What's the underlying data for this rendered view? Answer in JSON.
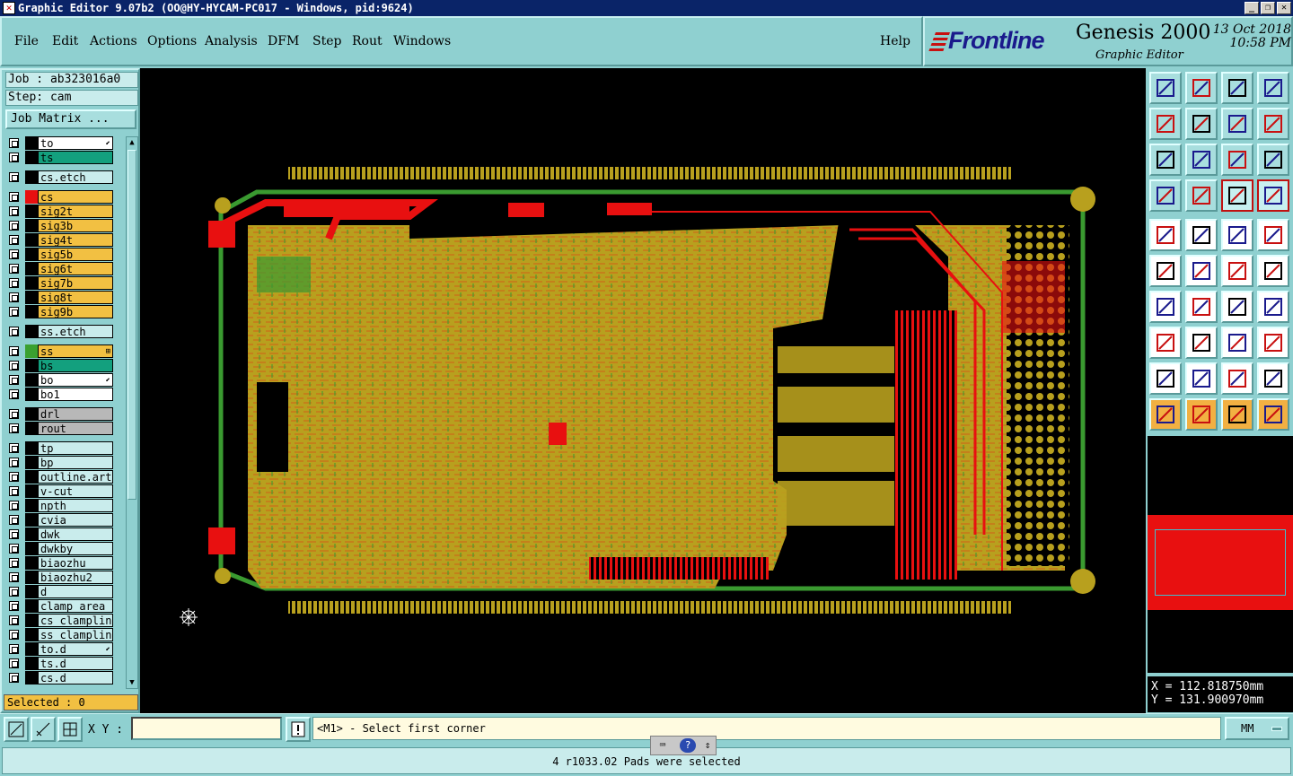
{
  "window": {
    "title": "Graphic Editor 9.07b2 (OO@HY-HYCAM-PC017 - Windows, pid:9624)"
  },
  "menu": {
    "items": [
      "File",
      "Edit",
      "Actions",
      "Options",
      "Analysis",
      "DFM",
      "Step",
      "Rout",
      "Windows"
    ],
    "help": "Help"
  },
  "brand": {
    "logo": "Frontline",
    "product": "Genesis 2000",
    "subtitle": "Graphic Editor",
    "date": "13 Oct 2018",
    "time": "10:58 PM"
  },
  "job": {
    "job_line": "Job : ab323016a0",
    "step_line": "Step: cam",
    "matrix_button": "Job Matrix ..."
  },
  "layers": [
    {
      "name": "to",
      "bg": "#ffffff",
      "swatch": "#000000",
      "mark": "⬋"
    },
    {
      "name": "ts",
      "bg": "#13a07e",
      "swatch": "#000000",
      "mark": ""
    },
    {
      "name": "cs.etch",
      "bg": "#c9ecec",
      "swatch": "#000000",
      "mark": ""
    },
    {
      "name": "cs",
      "bg": "#f2c042",
      "swatch": "#e81010",
      "mark": ""
    },
    {
      "name": "sig2t",
      "bg": "#f2c042",
      "swatch": "#000000",
      "mark": ""
    },
    {
      "name": "sig3b",
      "bg": "#f2c042",
      "swatch": "#000000",
      "mark": ""
    },
    {
      "name": "sig4t",
      "bg": "#f2c042",
      "swatch": "#000000",
      "mark": ""
    },
    {
      "name": "sig5b",
      "bg": "#f2c042",
      "swatch": "#000000",
      "mark": ""
    },
    {
      "name": "sig6t",
      "bg": "#f2c042",
      "swatch": "#000000",
      "mark": ""
    },
    {
      "name": "sig7b",
      "bg": "#f2c042",
      "swatch": "#000000",
      "mark": ""
    },
    {
      "name": "sig8t",
      "bg": "#f2c042",
      "swatch": "#000000",
      "mark": ""
    },
    {
      "name": "sig9b",
      "bg": "#f2c042",
      "swatch": "#000000",
      "mark": ""
    },
    {
      "name": "ss.etch",
      "bg": "#c9ecec",
      "swatch": "#000000",
      "mark": ""
    },
    {
      "name": "ss",
      "bg": "#f2c042",
      "swatch": "#3aa030",
      "mark": "⊞"
    },
    {
      "name": "bs",
      "bg": "#13a07e",
      "swatch": "#000000",
      "mark": ""
    },
    {
      "name": "bo",
      "bg": "#ffffff",
      "swatch": "#000000",
      "mark": "⬋"
    },
    {
      "name": "bo1",
      "bg": "#ffffff",
      "swatch": "#000000",
      "mark": ""
    },
    {
      "name": "drl",
      "bg": "#b8b8b8",
      "swatch": "#000000",
      "mark": ""
    },
    {
      "name": "rout",
      "bg": "#b8b8b8",
      "swatch": "#000000",
      "mark": ""
    },
    {
      "name": "tp",
      "bg": "#c9ecec",
      "swatch": "#000000",
      "mark": ""
    },
    {
      "name": "bp",
      "bg": "#c9ecec",
      "swatch": "#000000",
      "mark": ""
    },
    {
      "name": "outline.art",
      "bg": "#c9ecec",
      "swatch": "#000000",
      "mark": ""
    },
    {
      "name": "v-cut",
      "bg": "#c9ecec",
      "swatch": "#000000",
      "mark": ""
    },
    {
      "name": "npth",
      "bg": "#c9ecec",
      "swatch": "#000000",
      "mark": ""
    },
    {
      "name": "cvia",
      "bg": "#c9ecec",
      "swatch": "#000000",
      "mark": ""
    },
    {
      "name": "dwk",
      "bg": "#c9ecec",
      "swatch": "#000000",
      "mark": ""
    },
    {
      "name": "dwkby",
      "bg": "#c9ecec",
      "swatch": "#000000",
      "mark": ""
    },
    {
      "name": "biaozhu",
      "bg": "#c9ecec",
      "swatch": "#000000",
      "mark": ""
    },
    {
      "name": "biaozhu2",
      "bg": "#c9ecec",
      "swatch": "#000000",
      "mark": ""
    },
    {
      "name": "d",
      "bg": "#c9ecec",
      "swatch": "#000000",
      "mark": ""
    },
    {
      "name": "clamp_area",
      "bg": "#c9ecec",
      "swatch": "#000000",
      "mark": ""
    },
    {
      "name": "cs_clampline",
      "bg": "#c9ecec",
      "swatch": "#000000",
      "mark": ""
    },
    {
      "name": "ss_clampline",
      "bg": "#c9ecec",
      "swatch": "#000000",
      "mark": ""
    },
    {
      "name": "to.d",
      "bg": "#c9ecec",
      "swatch": "#000000",
      "mark": "⬋"
    },
    {
      "name": "ts.d",
      "bg": "#c9ecec",
      "swatch": "#000000",
      "mark": ""
    },
    {
      "name": "cs.d",
      "bg": "#c9ecec",
      "swatch": "#000000",
      "mark": ""
    }
  ],
  "selected_count": "Selected : 0",
  "coords": {
    "x": "X  =  112.818750mm",
    "y": "Y  =  131.900970mm"
  },
  "bottom": {
    "xy_label": "X Y :",
    "xy_value": "",
    "prompt": "<M1> - Select first corner",
    "units": "MM"
  },
  "status": "4 r1033.02 Pads were selected",
  "colors": {
    "canvas": "#000000",
    "copper": "#b8a01e",
    "copper_top": "#e81010",
    "silk": "#3a9a30",
    "panel": "#8fd0d0"
  }
}
